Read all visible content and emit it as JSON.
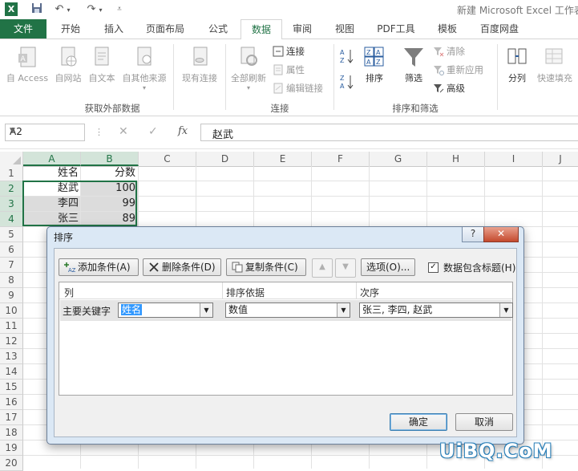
{
  "window": {
    "title": "新建 Microsoft Excel 工作表"
  },
  "tabs": [
    "文件",
    "开始",
    "插入",
    "页面布局",
    "公式",
    "数据",
    "审阅",
    "视图",
    "PDF工具",
    "模板",
    "百度网盘"
  ],
  "active_tab": "数据",
  "ribbon": {
    "external": {
      "access": "自 Access",
      "web": "自网站",
      "text": "自文本",
      "other": "自其他来源",
      "existing": "现有连接",
      "group_label": "获取外部数据"
    },
    "connections": {
      "refresh_all": "全部刷新",
      "connections": "连接",
      "properties": "属性",
      "edit_links": "编辑链接",
      "group_label": "连接"
    },
    "sort_filter": {
      "sort": "排序",
      "filter": "筛选",
      "clear": "清除",
      "reapply": "重新应用",
      "advanced": "高级",
      "group_label": "排序和筛选"
    },
    "tools": {
      "text_to_columns": "分列",
      "flash_fill": "快速填充"
    }
  },
  "formula_bar": {
    "name_box": "A2",
    "fx": "fx",
    "content": "赵武"
  },
  "grid": {
    "columns": [
      "A",
      "B",
      "C",
      "D",
      "E",
      "F",
      "G",
      "H",
      "I",
      "J"
    ],
    "rows": [
      "1",
      "2",
      "3",
      "4",
      "5",
      "6",
      "7",
      "8",
      "9",
      "10",
      "11",
      "12",
      "13",
      "14",
      "15",
      "16",
      "17",
      "18",
      "19",
      "20",
      "21"
    ],
    "cells": [
      [
        "姓名",
        "分数"
      ],
      [
        "赵武",
        "100"
      ],
      [
        "李四",
        "99"
      ],
      [
        "张三",
        "89"
      ]
    ]
  },
  "dialog": {
    "title": "排序",
    "help": "?",
    "close": "✕",
    "add_condition": "添加条件(A)",
    "delete_condition": "删除条件(D)",
    "copy_condition": "复制条件(C)",
    "options": "选项(O)...",
    "header_checkbox": "数据包含标题(H)",
    "header_checked": true,
    "columns": {
      "col": "列",
      "sort_on": "排序依据",
      "order": "次序"
    },
    "row": {
      "label": "主要关键字",
      "column_value": "姓名",
      "sort_on_value": "数值",
      "order_value": "张三, 李四, 赵武"
    },
    "ok": "确定",
    "cancel": "取消"
  },
  "watermark": "UiBQ.CoM"
}
